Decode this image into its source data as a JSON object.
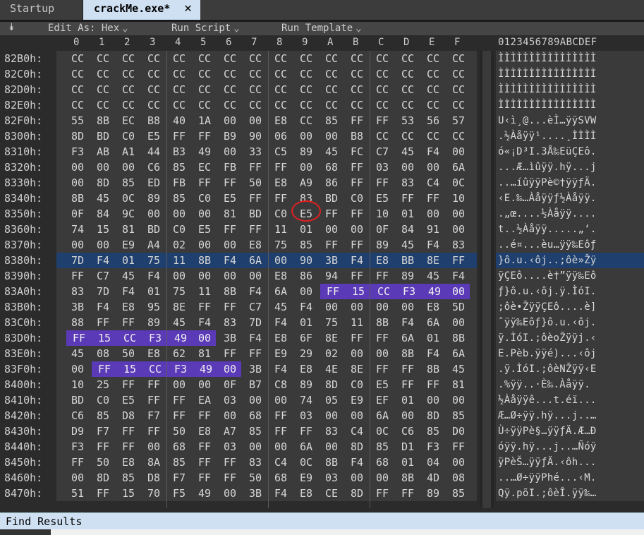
{
  "tabs": [
    {
      "label": "Startup"
    },
    {
      "label": "crackMe.exe*"
    }
  ],
  "toolbar": {
    "edit_as": "Edit As: Hex",
    "run_script": "Run Script",
    "run_template": "Run Template"
  },
  "column_headers": [
    "0",
    "1",
    "2",
    "3",
    "4",
    "5",
    "6",
    "7",
    "8",
    "9",
    "A",
    "B",
    "C",
    "D",
    "E",
    "F"
  ],
  "ascii_header": "0123456789ABCDEF",
  "rows": [
    {
      "addr": "82B0h:",
      "bytes": [
        "CC",
        "CC",
        "CC",
        "CC",
        "CC",
        "CC",
        "CC",
        "CC",
        "CC",
        "CC",
        "CC",
        "CC",
        "CC",
        "CC",
        "CC",
        "CC"
      ],
      "ascii": "ÌÌÌÌÌÌÌÌÌÌÌÌÌÌÌÌ"
    },
    {
      "addr": "82C0h:",
      "bytes": [
        "CC",
        "CC",
        "CC",
        "CC",
        "CC",
        "CC",
        "CC",
        "CC",
        "CC",
        "CC",
        "CC",
        "CC",
        "CC",
        "CC",
        "CC",
        "CC"
      ],
      "ascii": "ÌÌÌÌÌÌÌÌÌÌÌÌÌÌÌÌ"
    },
    {
      "addr": "82D0h:",
      "bytes": [
        "CC",
        "CC",
        "CC",
        "CC",
        "CC",
        "CC",
        "CC",
        "CC",
        "CC",
        "CC",
        "CC",
        "CC",
        "CC",
        "CC",
        "CC",
        "CC"
      ],
      "ascii": "ÌÌÌÌÌÌÌÌÌÌÌÌÌÌÌÌ"
    },
    {
      "addr": "82E0h:",
      "bytes": [
        "CC",
        "CC",
        "CC",
        "CC",
        "CC",
        "CC",
        "CC",
        "CC",
        "CC",
        "CC",
        "CC",
        "CC",
        "CC",
        "CC",
        "CC",
        "CC"
      ],
      "ascii": "ÌÌÌÌÌÌÌÌÌÌÌÌÌÌÌÌ"
    },
    {
      "addr": "82F0h:",
      "bytes": [
        "55",
        "8B",
        "EC",
        "B8",
        "40",
        "1A",
        "00",
        "00",
        "E8",
        "CC",
        "85",
        "FF",
        "FF",
        "53",
        "56",
        "57"
      ],
      "ascii": "U‹ì¸@...èÌ…ÿÿSVW"
    },
    {
      "addr": "8300h:",
      "bytes": [
        "8D",
        "BD",
        "C0",
        "E5",
        "FF",
        "FF",
        "B9",
        "90",
        "06",
        "00",
        "00",
        "B8",
        "CC",
        "CC",
        "CC",
        "CC"
      ],
      "ascii": ".½Àåÿÿ¹....¸ÌÌÌÌ"
    },
    {
      "addr": "8310h:",
      "bytes": [
        "F3",
        "AB",
        "A1",
        "44",
        "B3",
        "49",
        "00",
        "33",
        "C5",
        "89",
        "45",
        "FC",
        "C7",
        "45",
        "F4",
        "00"
      ],
      "ascii": "ó«¡D³I.3Å‰EüÇEô."
    },
    {
      "addr": "8320h:",
      "bytes": [
        "00",
        "00",
        "00",
        "C6",
        "85",
        "EC",
        "FB",
        "FF",
        "FF",
        "00",
        "68",
        "FF",
        "03",
        "00",
        "00",
        "6A"
      ],
      "ascii": "...Æ…ìûÿÿ.hÿ...j"
    },
    {
      "addr": "8330h:",
      "bytes": [
        "00",
        "8D",
        "85",
        "ED",
        "FB",
        "FF",
        "FF",
        "50",
        "E8",
        "A9",
        "86",
        "FF",
        "FF",
        "83",
        "C4",
        "0C"
      ],
      "ascii": "..…íûÿÿPè©†ÿÿƒÄ."
    },
    {
      "addr": "8340h:",
      "bytes": [
        "8B",
        "45",
        "0C",
        "89",
        "85",
        "C0",
        "E5",
        "FF",
        "FF",
        "83",
        "BD",
        "C0",
        "E5",
        "FF",
        "FF",
        "10"
      ],
      "ascii": "‹E.‰…Àåÿÿƒ½Àåÿÿ."
    },
    {
      "addr": "8350h:",
      "bytes": [
        "0F",
        "84",
        "9C",
        "00",
        "00",
        "00",
        "81",
        "BD",
        "C0",
        "E5",
        "FF",
        "FF",
        "10",
        "01",
        "00",
        "00"
      ],
      "ascii": ".„œ....½Àåÿÿ...."
    },
    {
      "addr": "8360h:",
      "bytes": [
        "74",
        "15",
        "81",
        "BD",
        "C0",
        "E5",
        "FF",
        "FF",
        "11",
        "01",
        "00",
        "00",
        "0F",
        "84",
        "91",
        "00"
      ],
      "ascii": "t..½Àåÿÿ.....„‘."
    },
    {
      "addr": "8370h:",
      "bytes": [
        "00",
        "00",
        "E9",
        "A4",
        "02",
        "00",
        "00",
        "E8",
        "75",
        "85",
        "FF",
        "FF",
        "89",
        "45",
        "F4",
        "83"
      ],
      "ascii": "..é¤...èu…ÿÿ‰Eôƒ"
    },
    {
      "addr": "8380h:",
      "bytes": [
        "7D",
        "F4",
        "01",
        "75",
        "11",
        "8B",
        "F4",
        "6A",
        "00",
        "90",
        "3B",
        "F4",
        "E8",
        "BB",
        "8E",
        "FF"
      ],
      "ascii": "}ô.u.‹ôj..;ôè»Žÿ"
    },
    {
      "addr": "8390h:",
      "bytes": [
        "FF",
        "C7",
        "45",
        "F4",
        "00",
        "00",
        "00",
        "00",
        "E8",
        "86",
        "94",
        "FF",
        "FF",
        "89",
        "45",
        "F4"
      ],
      "ascii": "ÿÇEô....è†”ÿÿ‰Eô"
    },
    {
      "addr": "83A0h:",
      "bytes": [
        "83",
        "7D",
        "F4",
        "01",
        "75",
        "11",
        "8B",
        "F4",
        "6A",
        "00",
        "FF",
        "15",
        "CC",
        "F3",
        "49",
        "00"
      ],
      "ascii": "ƒ}ô.u.‹ôj.ÿ.ÌóI."
    },
    {
      "addr": "83B0h:",
      "bytes": [
        "3B",
        "F4",
        "E8",
        "95",
        "8E",
        "FF",
        "FF",
        "C7",
        "45",
        "F4",
        "00",
        "00",
        "00",
        "00",
        "E8",
        "5D"
      ],
      "ascii": ";ôè•ŽÿÿÇEô....è]"
    },
    {
      "addr": "83C0h:",
      "bytes": [
        "88",
        "FF",
        "FF",
        "89",
        "45",
        "F4",
        "83",
        "7D",
        "F4",
        "01",
        "75",
        "11",
        "8B",
        "F4",
        "6A",
        "00"
      ],
      "ascii": "ˆÿÿ‰Eôƒ}ô.u.‹ôj."
    },
    {
      "addr": "83D0h:",
      "bytes": [
        "FF",
        "15",
        "CC",
        "F3",
        "49",
        "00",
        "3B",
        "F4",
        "E8",
        "6F",
        "8E",
        "FF",
        "FF",
        "6A",
        "01",
        "8B"
      ],
      "ascii": "ÿ.ÌóI.;ôèoŽÿÿj.‹"
    },
    {
      "addr": "83E0h:",
      "bytes": [
        "45",
        "08",
        "50",
        "E8",
        "62",
        "81",
        "FF",
        "FF",
        "E9",
        "29",
        "02",
        "00",
        "00",
        "8B",
        "F4",
        "6A"
      ],
      "ascii": "E.Pèb.ÿÿé)...‹ôj"
    },
    {
      "addr": "83F0h:",
      "bytes": [
        "00",
        "FF",
        "15",
        "CC",
        "F3",
        "49",
        "00",
        "3B",
        "F4",
        "E8",
        "4E",
        "8E",
        "FF",
        "FF",
        "8B",
        "45"
      ],
      "ascii": ".ÿ.ÌóI.;ôèNŽÿÿ‹E"
    },
    {
      "addr": "8400h:",
      "bytes": [
        "10",
        "25",
        "FF",
        "FF",
        "00",
        "00",
        "0F",
        "B7",
        "C8",
        "89",
        "8D",
        "C0",
        "E5",
        "FF",
        "FF",
        "81"
      ],
      "ascii": ".%ÿÿ..·È‰.Àåÿÿ."
    },
    {
      "addr": "8410h:",
      "bytes": [
        "BD",
        "C0",
        "E5",
        "FF",
        "FF",
        "EA",
        "03",
        "00",
        "00",
        "74",
        "05",
        "E9",
        "EF",
        "01",
        "00",
        "00"
      ],
      "ascii": "½Àåÿÿê...t.éï..."
    },
    {
      "addr": "8420h:",
      "bytes": [
        "C6",
        "85",
        "D8",
        "F7",
        "FF",
        "FF",
        "00",
        "68",
        "FF",
        "03",
        "00",
        "00",
        "6A",
        "00",
        "8D",
        "85"
      ],
      "ascii": "Æ…Ø÷ÿÿ.hÿ...j..…"
    },
    {
      "addr": "8430h:",
      "bytes": [
        "D9",
        "F7",
        "FF",
        "FF",
        "50",
        "E8",
        "A7",
        "85",
        "FF",
        "FF",
        "83",
        "C4",
        "0C",
        "C6",
        "85",
        "D0"
      ],
      "ascii": "Ù÷ÿÿPè§…ÿÿƒÄ.Æ…Ð"
    },
    {
      "addr": "8440h:",
      "bytes": [
        "F3",
        "FF",
        "FF",
        "00",
        "68",
        "FF",
        "03",
        "00",
        "00",
        "6A",
        "00",
        "8D",
        "85",
        "D1",
        "F3",
        "FF"
      ],
      "ascii": "óÿÿ.hÿ...j..…Ñóÿ"
    },
    {
      "addr": "8450h:",
      "bytes": [
        "FF",
        "50",
        "E8",
        "8A",
        "85",
        "FF",
        "FF",
        "83",
        "C4",
        "0C",
        "8B",
        "F4",
        "68",
        "01",
        "04",
        "00"
      ],
      "ascii": "ÿPèŠ…ÿÿƒÄ.‹ôh..."
    },
    {
      "addr": "8460h:",
      "bytes": [
        "00",
        "8D",
        "85",
        "D8",
        "F7",
        "FF",
        "FF",
        "50",
        "68",
        "E9",
        "03",
        "00",
        "00",
        "8B",
        "4D",
        "08"
      ],
      "ascii": "..…Ø÷ÿÿPhé...‹M."
    },
    {
      "addr": "8470h:",
      "bytes": [
        "51",
        "FF",
        "15",
        "70",
        "F5",
        "49",
        "00",
        "3B",
        "F4",
        "E8",
        "CE",
        "8D",
        "FF",
        "FF",
        "89",
        "85"
      ],
      "ascii": "Qÿ.põI.;ôèÎ.ÿÿ‰…"
    }
  ],
  "selected_row": 13,
  "highlights": [
    {
      "row": 15,
      "from": 10,
      "to": 15
    },
    {
      "row": 18,
      "from": 0,
      "to": 5
    },
    {
      "row": 20,
      "from": 1,
      "to": 6
    }
  ],
  "find_results_label": "Find Results",
  "colors": {
    "selection": "#1f3f6e",
    "highlight": "#5b3ab8",
    "annotation": "#e02020"
  }
}
